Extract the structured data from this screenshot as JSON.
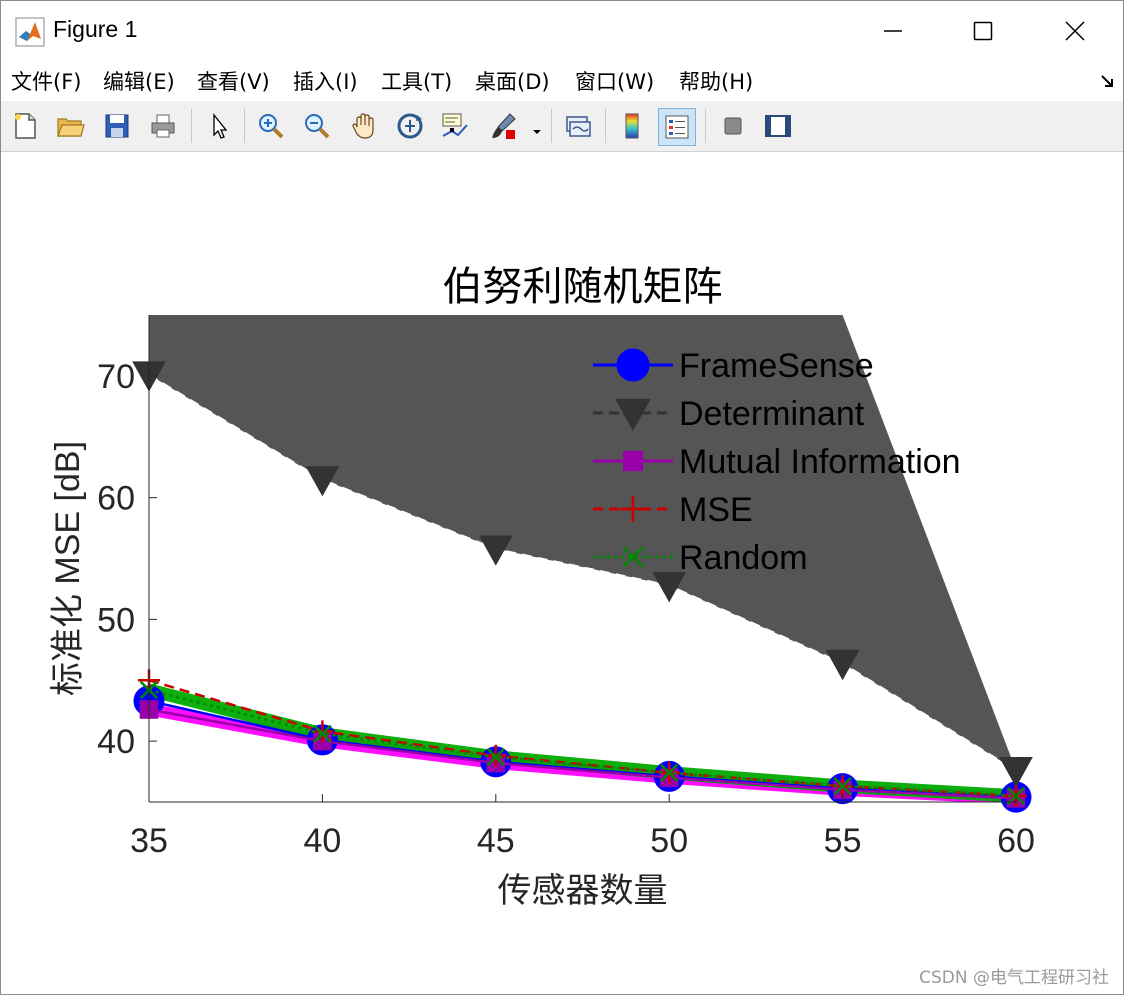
{
  "window": {
    "title": "Figure 1"
  },
  "menu": [
    {
      "label": "文件(F)"
    },
    {
      "label": "编辑(E)"
    },
    {
      "label": "查看(V)"
    },
    {
      "label": "插入(I)"
    },
    {
      "label": "工具(T)"
    },
    {
      "label": "桌面(D)"
    },
    {
      "label": "窗口(W)"
    },
    {
      "label": "帮助(H)"
    }
  ],
  "toolbar": {
    "icons": [
      "new-file-icon",
      "open-folder-icon",
      "save-icon",
      "print-icon",
      "pointer-icon",
      "zoom-in-icon",
      "zoom-out-icon",
      "pan-hand-icon",
      "rotate-3d-icon",
      "data-cursor-icon",
      "brush-icon",
      "link-plot-icon",
      "colorbar-icon",
      "legend-icon",
      "hide-plot-tools-icon",
      "show-plot-tools-icon"
    ]
  },
  "watermark": "CSDN @电气工程研习社",
  "colors": {
    "framesense": "#0000ff",
    "determinant": "#333333",
    "mutual": "#9900aa",
    "mse": "#cc0000",
    "random": "#008800",
    "fill_dark": "#555555",
    "fill_mutual": "#ff00ff",
    "fill_random": "#00aa00"
  },
  "chart_data": {
    "type": "line",
    "title": "伯努利随机矩阵",
    "xlabel": "传感器数量",
    "ylabel": "标准化 MSE [dB]",
    "x": [
      35,
      40,
      45,
      50,
      55,
      60
    ],
    "xlim": [
      35,
      60
    ],
    "ylim": [
      35,
      75
    ],
    "xticks": [
      "35",
      "40",
      "45",
      "50",
      "55",
      "60"
    ],
    "yticks": [
      "40",
      "50",
      "60",
      "70"
    ],
    "legend_position": "top-right",
    "series": [
      {
        "name": "FrameSense",
        "values": [
          43.3,
          40.1,
          38.3,
          37.1,
          36.1,
          35.4
        ],
        "marker": "circle",
        "style": "solid"
      },
      {
        "name": "Determinant",
        "values": [
          70.1,
          61.5,
          55.8,
          52.8,
          46.4,
          37.6
        ],
        "marker": "triangle-down",
        "style": "dashed",
        "band_upper": [
          75,
          75,
          75,
          75,
          75,
          37.6
        ]
      },
      {
        "name": "Mutual Information",
        "values": [
          42.6,
          40.0,
          38.2,
          37.0,
          36.0,
          35.3
        ],
        "marker": "square",
        "style": "solid"
      },
      {
        "name": "MSE",
        "values": [
          45.0,
          40.8,
          38.8,
          37.4,
          36.3,
          35.5
        ],
        "marker": "plus",
        "style": "dashed"
      },
      {
        "name": "Random",
        "values": [
          44.2,
          40.6,
          38.7,
          37.4,
          36.3,
          35.5
        ],
        "marker": "x",
        "style": "dotted"
      }
    ]
  }
}
